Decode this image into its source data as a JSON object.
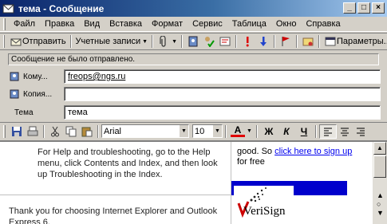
{
  "window": {
    "title": "тема - Сообщение"
  },
  "menubar": {
    "items": [
      "Файл",
      "Правка",
      "Вид",
      "Вставка",
      "Формат",
      "Сервис",
      "Таблица",
      "Окно",
      "Справка"
    ]
  },
  "toolbar": {
    "send_label": "Отправить",
    "accounts_label": "Учетные записи",
    "options_label": "Параметры..."
  },
  "infobar": {
    "text": "Сообщение не было отправлено."
  },
  "fields": {
    "to_label": "Кому...",
    "to_value": "freops@ngs.ru",
    "cc_label": "Копия...",
    "cc_value": "",
    "subject_label": "Тема",
    "subject_value": "тема"
  },
  "format": {
    "font": "Arial",
    "size": "10",
    "color_letter": "A",
    "bold": "Ж",
    "italic": "К",
    "underline": "Ч"
  },
  "body": {
    "help_text": "For Help and troubleshooting, go to the Help menu, click Contents and Index, and then look up Troubleshooting in the Index.",
    "thank_text": "Thank you for choosing Internet Explorer and Outlook Express 6.",
    "promo_text_1": "good. So",
    "promo_link": "click here to sign up",
    "promo_text_2": "for free",
    "logo_text": "VeriSign"
  },
  "colors": {
    "title_start": "#0a246a",
    "title_end": "#a6caf0",
    "link": "#0000ee",
    "band": "#0000cc"
  }
}
